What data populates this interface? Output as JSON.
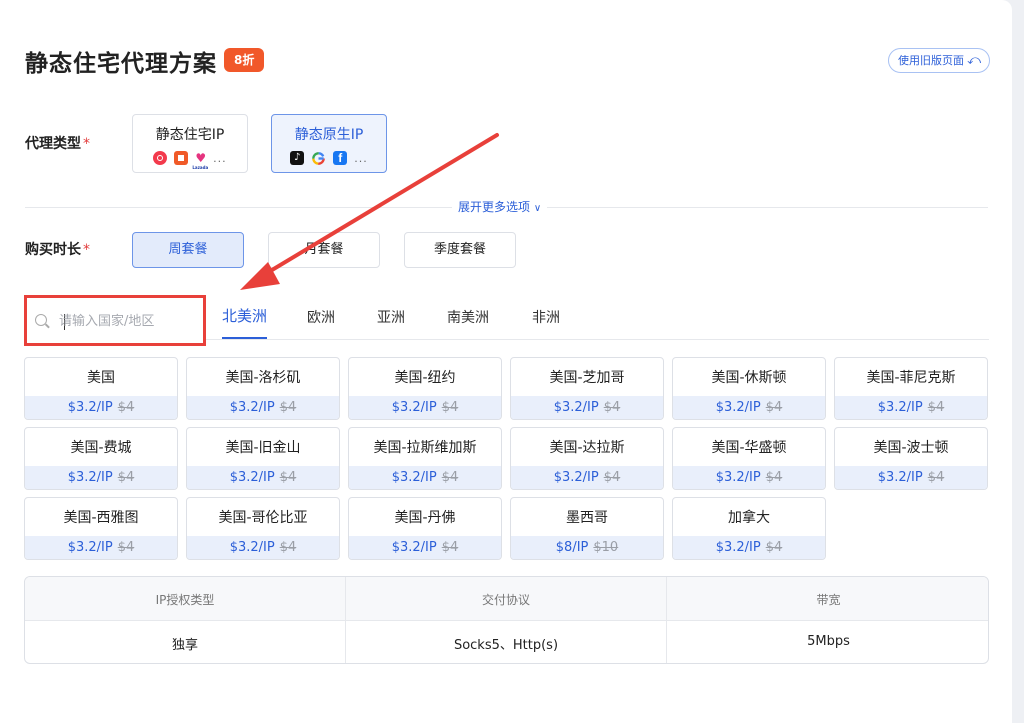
{
  "header": {
    "title": "静态住宅代理方案",
    "discount_badge": "8折",
    "old_version_button": "使用旧版页面"
  },
  "proxy_type": {
    "label": "代理类型",
    "options": [
      {
        "label": "静态住宅IP",
        "icons": [
          "red-circle-app-icon",
          "red-square-app-icon",
          "lazada-heart-icon"
        ],
        "icon_text": {
          "lazada": "Lazada"
        },
        "more": "...",
        "selected": false
      },
      {
        "label": "静态原生IP",
        "icons": [
          "tiktok-icon",
          "google-icon",
          "facebook-icon"
        ],
        "more": "...",
        "selected": true
      }
    ]
  },
  "expand_more": "展开更多选项",
  "duration": {
    "label": "购买时长",
    "options": [
      {
        "label": "周套餐",
        "selected": true
      },
      {
        "label": "月套餐",
        "selected": false
      },
      {
        "label": "季度套餐",
        "selected": false
      }
    ]
  },
  "search": {
    "placeholder": "请输入国家/地区",
    "value": ""
  },
  "region_tabs": [
    {
      "label": "北美洲",
      "active": true
    },
    {
      "label": "欧洲",
      "active": false
    },
    {
      "label": "亚洲",
      "active": false
    },
    {
      "label": "南美洲",
      "active": false
    },
    {
      "label": "非洲",
      "active": false
    }
  ],
  "regions": [
    {
      "name": "美国",
      "price": "$3.2/IP",
      "original": "$4"
    },
    {
      "name": "美国-洛杉矶",
      "price": "$3.2/IP",
      "original": "$4"
    },
    {
      "name": "美国-纽约",
      "price": "$3.2/IP",
      "original": "$4"
    },
    {
      "name": "美国-芝加哥",
      "price": "$3.2/IP",
      "original": "$4"
    },
    {
      "name": "美国-休斯顿",
      "price": "$3.2/IP",
      "original": "$4"
    },
    {
      "name": "美国-菲尼克斯",
      "price": "$3.2/IP",
      "original": "$4"
    },
    {
      "name": "美国-费城",
      "price": "$3.2/IP",
      "original": "$4"
    },
    {
      "name": "美国-旧金山",
      "price": "$3.2/IP",
      "original": "$4"
    },
    {
      "name": "美国-拉斯维加斯",
      "price": "$3.2/IP",
      "original": "$4"
    },
    {
      "name": "美国-达拉斯",
      "price": "$3.2/IP",
      "original": "$4"
    },
    {
      "name": "美国-华盛顿",
      "price": "$3.2/IP",
      "original": "$4"
    },
    {
      "name": "美国-波士顿",
      "price": "$3.2/IP",
      "original": "$4"
    },
    {
      "name": "美国-西雅图",
      "price": "$3.2/IP",
      "original": "$4"
    },
    {
      "name": "美国-哥伦比亚",
      "price": "$3.2/IP",
      "original": "$4"
    },
    {
      "name": "美国-丹佛",
      "price": "$3.2/IP",
      "original": "$4"
    },
    {
      "name": "墨西哥",
      "price": "$8/IP",
      "original": "$10"
    },
    {
      "name": "加拿大",
      "price": "$3.2/IP",
      "original": "$4"
    }
  ],
  "specs": [
    {
      "header": "IP授权类型",
      "value": "独享"
    },
    {
      "header": "交付协议",
      "value": "Socks5、Http(s)"
    },
    {
      "header": "带宽",
      "value": "5Mbps"
    }
  ],
  "colors": {
    "accent": "#2c5fd8",
    "discount": "#f1582a",
    "highlight_box": "#e8403a",
    "annotation_arrow": "#e8403a"
  }
}
